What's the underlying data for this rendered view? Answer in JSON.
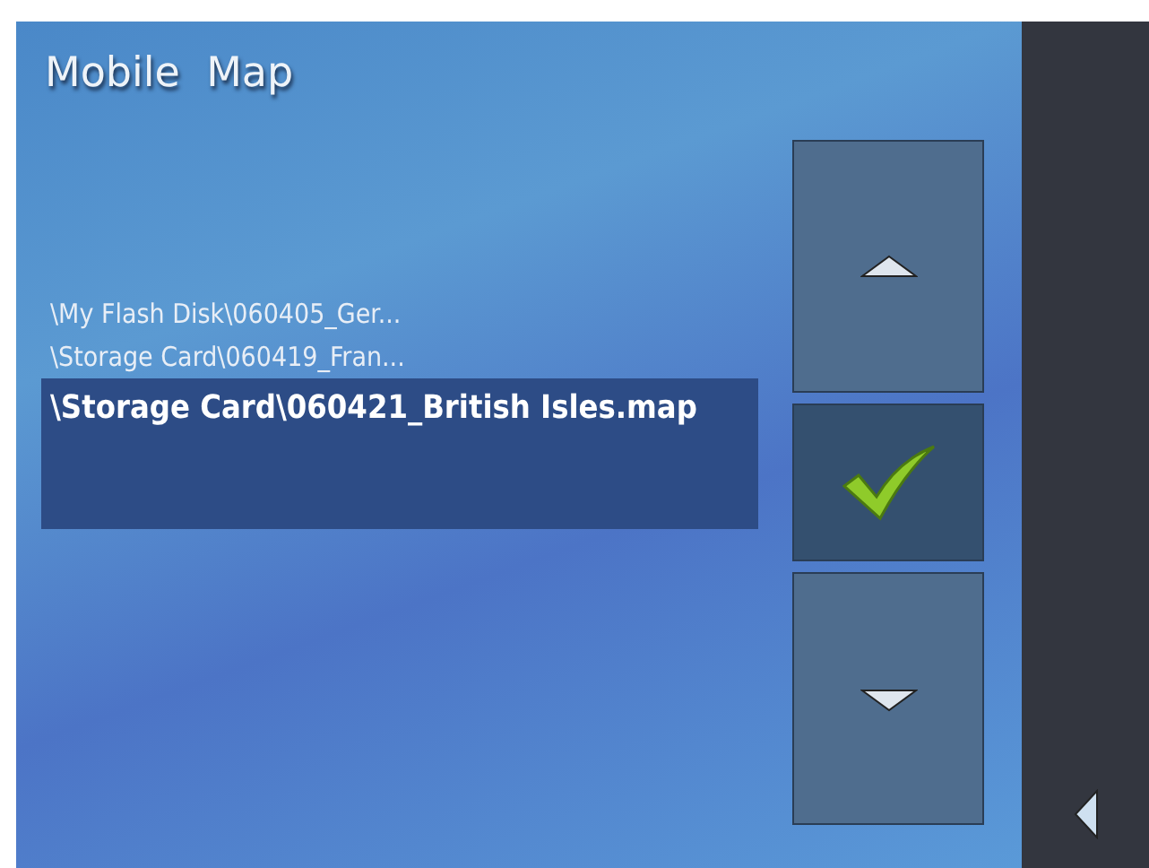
{
  "title": "Mobile  Map",
  "files": [
    {
      "label": "\\My Flash Disk\\060405_Ger...",
      "selected": false
    },
    {
      "label": "\\Storage Card\\060419_Fran...",
      "selected": false
    },
    {
      "label": "\\Storage Card\\060421_British Isles.map",
      "selected": true
    }
  ]
}
